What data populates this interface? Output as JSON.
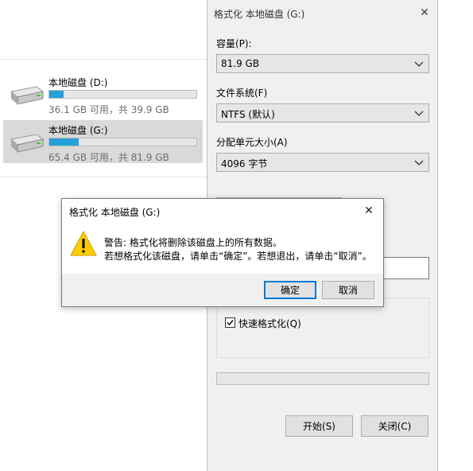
{
  "explorer": {
    "drives": [
      {
        "name": "本地磁盘 (D:)",
        "free_text": "36.1 GB 可用，共 39.9 GB",
        "used_fraction": 0.095
      },
      {
        "name": "本地磁盘 (G:)",
        "free_text": "65.4 GB 可用，共 81.9 GB",
        "used_fraction": 0.2
      }
    ]
  },
  "format_dialog": {
    "title": "格式化 本地磁盘 (G:)",
    "capacity_label": "容量(P):",
    "capacity_value": "81.9 GB",
    "filesystem_label": "文件系统(F)",
    "filesystem_value": "NTFS (默认)",
    "allocation_label": "分配单元大小(A)",
    "allocation_value": "4096 字节",
    "quick_format_label": "快速格式化(Q)",
    "quick_format_checked": true,
    "start_button": "开始(S)",
    "close_button": "关闭(C)"
  },
  "warning_dialog": {
    "title": "格式化 本地磁盘 (G:)",
    "line1": "警告: 格式化将删除该磁盘上的所有数据。",
    "line2": "若想格式化该磁盘，请单击“确定”。若想退出，请单击“取消”。",
    "ok_button": "确定",
    "cancel_button": "取消",
    "icon": "warning-icon"
  },
  "colors": {
    "accent": "#0078d7",
    "drive_bar": "#26a0da",
    "selection": "#d9d9d9",
    "warning": "#ffcc00"
  }
}
